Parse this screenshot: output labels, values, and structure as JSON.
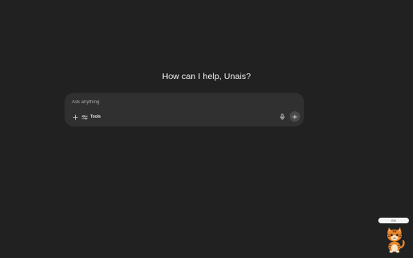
{
  "main": {
    "greeting": "How can I help, Unais?"
  },
  "composer": {
    "placeholder": "Ask anything",
    "value": "",
    "tools_label": "Tools",
    "icons": {
      "add": "plus-icon",
      "tools": "sliders-icon",
      "dictate": "microphone-icon",
      "voice": "voice-waveform-icon"
    }
  },
  "pet": {
    "progress_label": "0%",
    "progress": 0,
    "mascot": "tiger-cat-icon"
  },
  "colors": {
    "background": "#212121",
    "composer": "#303030",
    "text": "#ececec",
    "muted_text": "#a8a8a8",
    "voice_button": "#4a4a4a",
    "mascot_orange": "#e8862e"
  }
}
